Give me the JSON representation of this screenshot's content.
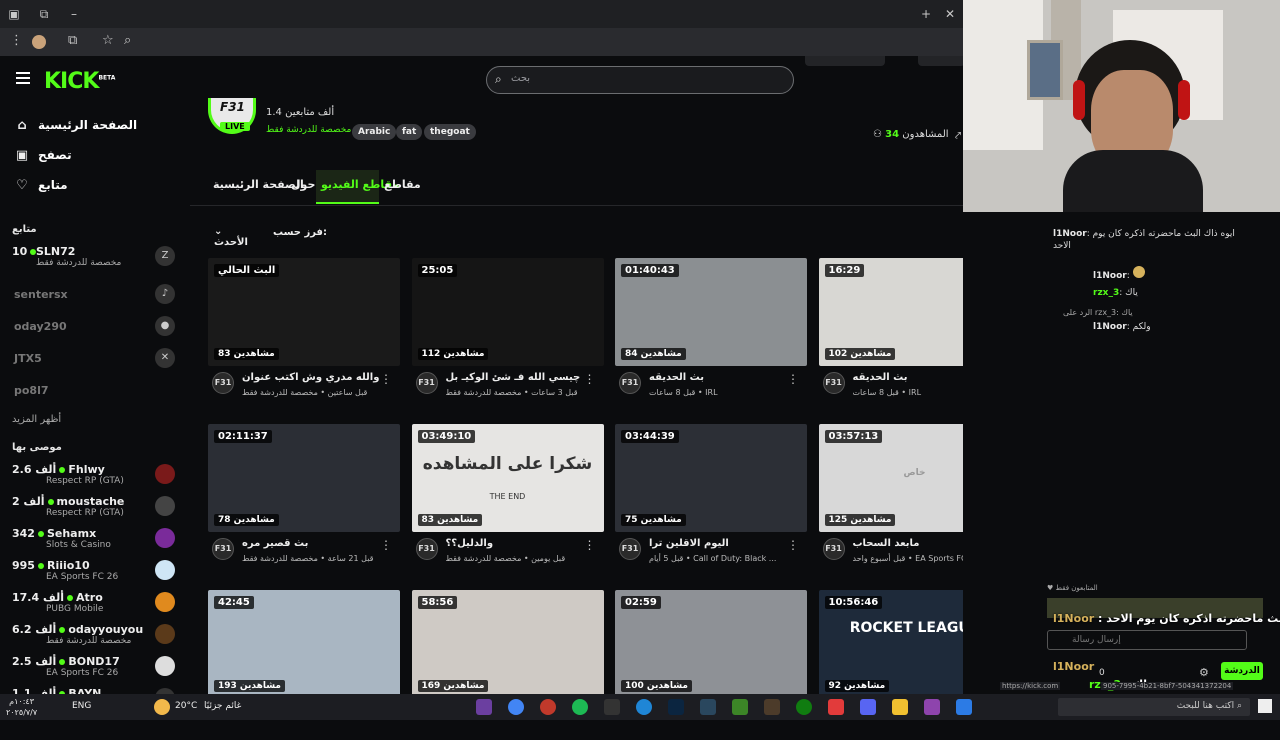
{
  "browser": {
    "menu_glyph": "⋮",
    "new_tab": "+",
    "minimize": "–",
    "restore": "⧉",
    "close": "✕",
    "profile_icon": "profile-icon",
    "bookmark": "☆",
    "zoom": "⌕",
    "extensions_glyph": "⧉",
    "page_info_glyph": "⊙",
    "status_url": "https://kick.com"
  },
  "header": {
    "logo": "KICK",
    "logo_badge": "BETA",
    "search_placeholder": "بحث",
    "search_glyph": "⌕"
  },
  "sidebar": {
    "nav": [
      {
        "label": "الصفحة الرئيسية",
        "icon": "⌂"
      },
      {
        "label": "تصفح",
        "icon": "▣"
      },
      {
        "label": "متابع",
        "icon": "♡"
      }
    ],
    "following_title": "متابع",
    "following": [
      {
        "name": "SLN72",
        "count": "10",
        "category": "مخصصة للدردشة فقط",
        "live": true
      },
      {
        "name": "sentersx",
        "live": false
      },
      {
        "name": "oday290",
        "live": false
      },
      {
        "name": "JTX5",
        "live": false
      },
      {
        "name": "po8l7",
        "live": false
      }
    ],
    "show_more": "أظهر المزيد",
    "recommended_title": "موصى بها",
    "recommended": [
      {
        "name": "Fhlwy",
        "count": "2.6 ألف",
        "category": "Respect RP (GTA)"
      },
      {
        "name": "moustache",
        "count": "2 ألف",
        "category": "Respect RP (GTA)"
      },
      {
        "name": "Sehamx",
        "count": "342",
        "category": "Slots & Casino"
      },
      {
        "name": "Riiio10",
        "count": "995",
        "category": "EA Sports FC 26"
      },
      {
        "name": "Atro",
        "count": "17.4 ألف",
        "category": "PUBG Mobile"
      },
      {
        "name": "odayyouyou",
        "count": "6.2 ألف",
        "category": "مخصصة للدردشة فقط"
      },
      {
        "name": "BOND17",
        "count": "2.5 ألف",
        "category": "EA Sports FC 26"
      },
      {
        "name": "BAYN",
        "count": "1.1 ألف",
        "category": ""
      }
    ]
  },
  "channel": {
    "avatar_text": "F31",
    "live_badge": "LIVE",
    "followers": "1.4 ألف متابعين",
    "category": "مخصصة للدردشة فقط",
    "tags": [
      "Arabic",
      "fat",
      "thegoat"
    ],
    "viewers_label": "المشاهدون",
    "viewers": "34",
    "tabs": [
      "الصفحة الرئيسية",
      "حول",
      "مقاطع الفيديو",
      "مقاطع"
    ],
    "sort_label": "فرز حسب:",
    "sort_value": "الأحدث"
  },
  "videos": [
    {
      "duration": "البث الحالي",
      "views": "83 مشاهدين",
      "title": "والله مدري وش اكتب عنوان",
      "meta": "قبل ساعتين • مخصصة للدردشة فقط"
    },
    {
      "duration": "25:05",
      "views": "112 مشاهدين",
      "title": "چيسي الله فـ شئ الوكيـ بل",
      "meta": "قبل 3 ساعات • مخصصة للدردشة فقط"
    },
    {
      "duration": "01:40:43",
      "views": "84 مشاهدين",
      "title": "بث الحديقه",
      "meta": "قبل 8 ساعات • IRL"
    },
    {
      "duration": "16:29",
      "views": "102 مشاهدين",
      "title": "بث الحديقه",
      "meta": "قبل 8 ساعات • IRL"
    },
    {
      "duration": "02:11:37",
      "views": "78 مشاهدين",
      "title": "بث قصير مره",
      "meta": "قبل 21 ساعة • مخصصة للدردشة فقط"
    },
    {
      "duration": "03:49:10",
      "views": "83 مشاهدين",
      "title": "والدليل؟؟",
      "meta": "قبل يومين • مخصصة للدردشة فقط",
      "thumb_text": "شكرا على المشاهده",
      "thumb_sub": "THE END"
    },
    {
      "duration": "03:44:39",
      "views": "75 مشاهدين",
      "title": "اليوم الاقلين ترا",
      "meta": "قبل 5 أيام • Call of Duty: Black ..."
    },
    {
      "duration": "03:57:13",
      "views": "125 مشاهدين",
      "title": "مابعد السحاب",
      "meta": "قبل أسبوع واحد • EA Sports FC 26",
      "thumb_text": "خاص"
    },
    {
      "duration": "42:45",
      "views": "193 مشاهدين"
    },
    {
      "duration": "58:56",
      "views": "169 مشاهدين"
    },
    {
      "duration": "02:59",
      "views": "100 مشاهدين"
    },
    {
      "duration": "10:56:46",
      "views": "92 مشاهدين",
      "thumb_text": "ROCKET LEAGUE"
    }
  ],
  "chat": {
    "messages": [
      {
        "user": "l1Noor",
        "text": "ايوه ذاك البث ماحضرته اذكره كان يوم الاحد"
      },
      {
        "user": "l1Noor",
        "text": ""
      },
      {
        "user": "rzx_3",
        "text": "ياك"
      },
      {
        "reply": "الرد على rzx_3: ياك",
        "user": "l1Noor",
        "text": "ولكم"
      }
    ],
    "followers_only": "المتابعون فقط",
    "overlay_1": "ايوه ذاك البث ماحضرته اذكره كان يوم الاحد",
    "overlay_user": "l1Noor",
    "input_placeholder": "إرسال رسالة",
    "send": "الدردشة",
    "viewer_count": "0",
    "overlay_2_user": "l1Noor",
    "overlay_3_user": "rzx_3",
    "overlay_3_text": "ياك",
    "overlay_4_user": "l1Noor",
    "overlay_4_text": "اكتب هنا للبحث وكم",
    "status_uuid": "905-7995-4b21-8bf7-504341372204"
  },
  "taskbar": {
    "time": "١٠:٤٣م",
    "date": "٢٠٢٥/٧/٧",
    "lang": "ENG",
    "weather": "20°C",
    "weather_desc": "غائم جزئيًا",
    "search_placeholder": "اكتب هنا للبحث"
  },
  "colors": {
    "accent": "#53fc18",
    "bg": "#0b0c0e",
    "panel": "#1f2023"
  }
}
